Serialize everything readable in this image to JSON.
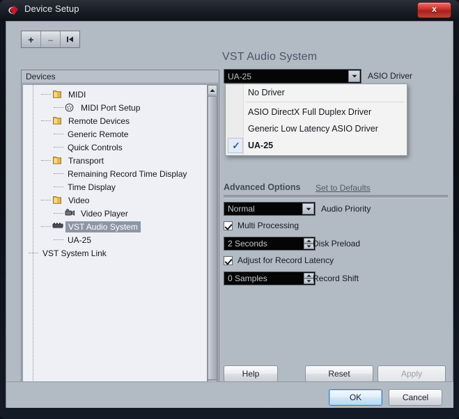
{
  "window": {
    "title": "Device Setup",
    "icon": "cubase-logo-icon",
    "close_label": "x"
  },
  "toolbar": {
    "add_label": "+",
    "remove_label": "–",
    "reset_label": "⏮"
  },
  "devices_panel": {
    "header": "Devices",
    "items": [
      {
        "label": "MIDI",
        "indent": 1,
        "icon": "folder-icon",
        "selected": false
      },
      {
        "label": "MIDI Port Setup",
        "indent": 2,
        "icon": "midi-port-icon",
        "selected": false
      },
      {
        "label": "Remote Devices",
        "indent": 1,
        "icon": "folder-icon",
        "selected": false
      },
      {
        "label": "Generic Remote",
        "indent": 2,
        "icon": "none",
        "selected": false
      },
      {
        "label": "Quick Controls",
        "indent": 2,
        "icon": "none",
        "selected": false
      },
      {
        "label": "Transport",
        "indent": 1,
        "icon": "folder-icon",
        "selected": false
      },
      {
        "label": "Remaining Record Time Display",
        "indent": 2,
        "icon": "none",
        "selected": false
      },
      {
        "label": "Time Display",
        "indent": 2,
        "icon": "none",
        "selected": false
      },
      {
        "label": "Video",
        "indent": 1,
        "icon": "folder-icon",
        "selected": false
      },
      {
        "label": "Video Player",
        "indent": 2,
        "icon": "video-player-icon",
        "selected": false
      },
      {
        "label": "VST Audio System",
        "indent": 1,
        "icon": "audio-card-icon",
        "selected": true
      },
      {
        "label": "UA-25",
        "indent": 2,
        "icon": "none",
        "selected": false
      },
      {
        "label": "VST System Link",
        "indent": 0,
        "icon": "none",
        "selected": false
      }
    ]
  },
  "main": {
    "title": "VST Audio System",
    "asio_driver": {
      "value": "UA-25",
      "label": "ASIO Driver",
      "options": [
        {
          "label": "No Driver",
          "checked": false,
          "separator_after": true
        },
        {
          "label": "ASIO DirectX Full Duplex Driver",
          "checked": false,
          "separator_after": false
        },
        {
          "label": "Generic Low Latency ASIO Driver",
          "checked": false,
          "separator_after": false
        },
        {
          "label": "UA-25",
          "checked": true,
          "separator_after": false
        }
      ],
      "check_glyph": "✓"
    },
    "advanced": {
      "title": "Advanced Options",
      "set_defaults_label": "Set to Defaults",
      "audio_priority": {
        "value": "Normal",
        "label": "Audio Priority"
      },
      "multi_processing": {
        "label": "Multi Processing",
        "checked": true
      },
      "disk_preload": {
        "value": "2 Seconds",
        "label": "Disk Preload"
      },
      "adjust_record_latency": {
        "label": "Adjust for Record Latency",
        "checked": true
      },
      "record_shift": {
        "value": "0 Samples",
        "label": "Record Shift"
      }
    }
  },
  "buttons": {
    "help": "Help",
    "reset": "Reset",
    "apply": "Apply",
    "ok": "OK",
    "cancel": "Cancel"
  },
  "colors": {
    "dialog_bg": "#b2bac4",
    "accent_blue": "#2b5ea8",
    "title_slate": "#4a5663",
    "selection": "#8d96a6",
    "close_red": "#c0433c"
  }
}
